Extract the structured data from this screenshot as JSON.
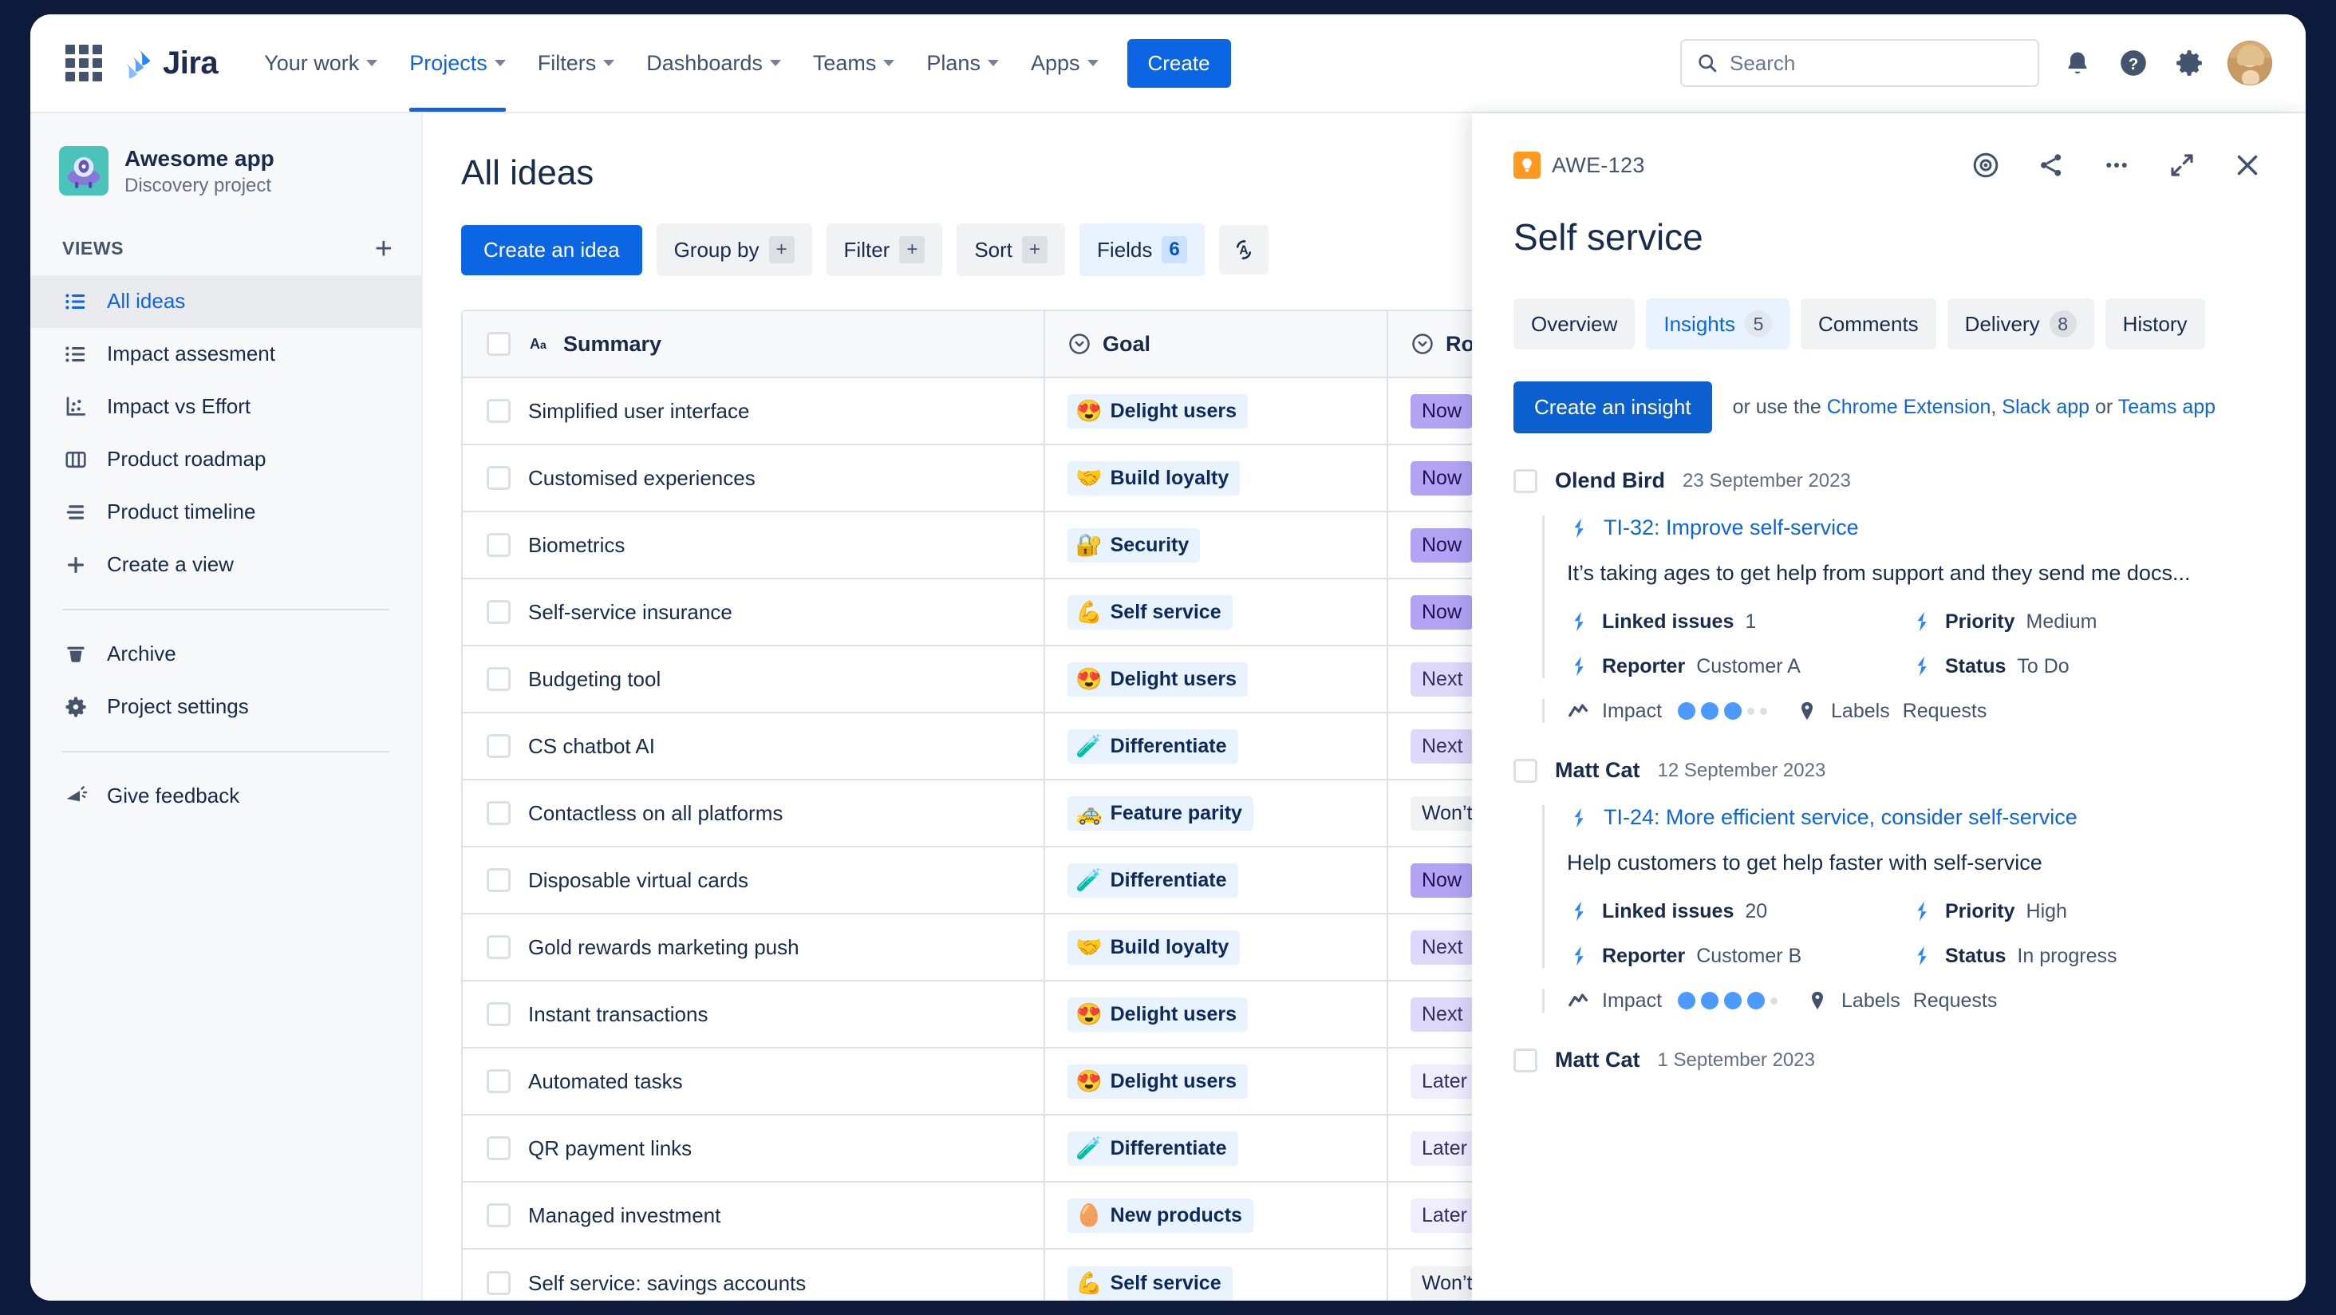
{
  "topnav": {
    "brand": "Jira",
    "items": [
      {
        "label": "Your work",
        "active": false
      },
      {
        "label": "Projects",
        "active": true
      },
      {
        "label": "Filters",
        "active": false
      },
      {
        "label": "Dashboards",
        "active": false
      },
      {
        "label": "Teams",
        "active": false
      },
      {
        "label": "Plans",
        "active": false
      },
      {
        "label": "Apps",
        "active": false
      }
    ],
    "create_label": "Create",
    "search_placeholder": "Search",
    "icons": [
      "notification-bell-icon",
      "help-icon",
      "settings-gear-icon",
      "user-avatar"
    ]
  },
  "sidebar": {
    "project_name": "Awesome app",
    "project_type": "Discovery project",
    "views_label": "VIEWS",
    "add_view_label": "+",
    "views": [
      {
        "label": "All ideas",
        "icon": "list-view-icon",
        "active": true
      },
      {
        "label": "Impact assesment",
        "icon": "list-view-icon",
        "active": false
      },
      {
        "label": "Impact vs Effort",
        "icon": "scatter-chart-icon",
        "active": false
      },
      {
        "label": "Product roadmap",
        "icon": "board-columns-icon",
        "active": false
      },
      {
        "label": "Product timeline",
        "icon": "timeline-icon",
        "active": false
      },
      {
        "label": "Create a view",
        "icon": "plus-icon",
        "active": false
      }
    ],
    "footer_items": [
      {
        "label": "Archive",
        "icon": "trash-icon"
      },
      {
        "label": "Project settings",
        "icon": "gear-icon"
      }
    ],
    "feedback": {
      "label": "Give feedback",
      "icon": "megaphone-icon"
    }
  },
  "main": {
    "page_title": "All ideas",
    "toolbar": {
      "create_idea": "Create an idea",
      "group_by": {
        "label": "Group by",
        "badge": "+"
      },
      "filter": {
        "label": "Filter",
        "badge": "+"
      },
      "sort": {
        "label": "Sort",
        "badge": "+"
      },
      "fields": {
        "label": "Fields",
        "badge": "6"
      },
      "autosize_icon": "text-autosize-icon"
    },
    "table": {
      "columns": [
        {
          "label": "Summary",
          "icon": "text-field-icon"
        },
        {
          "label": "Goal",
          "icon": "select-field-icon"
        },
        {
          "label": "Roadmap",
          "icon": "select-field-icon"
        }
      ],
      "rows": [
        {
          "summary": "Simplified user interface",
          "goal": "Delight users",
          "goal_emoji": "😍",
          "roadmap": "Now",
          "roadmap_style": "now"
        },
        {
          "summary": "Customised experiences",
          "goal": "Build loyalty",
          "goal_emoji": "🤝",
          "roadmap": "Now",
          "roadmap_style": "now"
        },
        {
          "summary": "Biometrics",
          "goal": "Security",
          "goal_emoji": "🔐",
          "roadmap": "Now",
          "roadmap_style": "now"
        },
        {
          "summary": "Self-service insurance",
          "goal": "Self service",
          "goal_emoji": "💪",
          "roadmap": "Now",
          "roadmap_style": "now"
        },
        {
          "summary": "Budgeting tool",
          "goal": "Delight users",
          "goal_emoji": "😍",
          "roadmap": "Next",
          "roadmap_style": "next"
        },
        {
          "summary": "CS chatbot AI",
          "goal": "Differentiate",
          "goal_emoji": "🧪",
          "roadmap": "Next",
          "roadmap_style": "next"
        },
        {
          "summary": "Contactless on all platforms",
          "goal": "Feature parity",
          "goal_emoji": "🚕",
          "roadmap": "Won’t do",
          "roadmap_style": "wont"
        },
        {
          "summary": "Disposable virtual cards",
          "goal": "Differentiate",
          "goal_emoji": "🧪",
          "roadmap": "Now",
          "roadmap_style": "now"
        },
        {
          "summary": "Gold rewards marketing push",
          "goal": "Build loyalty",
          "goal_emoji": "🤝",
          "roadmap": "Next",
          "roadmap_style": "next"
        },
        {
          "summary": "Instant transactions",
          "goal": "Delight users",
          "goal_emoji": "😍",
          "roadmap": "Next",
          "roadmap_style": "next"
        },
        {
          "summary": "Automated tasks",
          "goal": "Delight users",
          "goal_emoji": "😍",
          "roadmap": "Later",
          "roadmap_style": "later"
        },
        {
          "summary": "QR payment links",
          "goal": "Differentiate",
          "goal_emoji": "🧪",
          "roadmap": "Later",
          "roadmap_style": "later"
        },
        {
          "summary": "Managed investment",
          "goal": "New products",
          "goal_emoji": "🥚",
          "roadmap": "Later",
          "roadmap_style": "later"
        },
        {
          "summary": "Self service: savings accounts",
          "goal": "Self service",
          "goal_emoji": "💪",
          "roadmap": "Won’t do",
          "roadmap_style": "wont"
        }
      ]
    }
  },
  "panel": {
    "issue_key": "AWE-123",
    "title": "Self service",
    "actions": [
      "watch-eye-icon",
      "share-icon",
      "more-options-icon",
      "expand-icon",
      "close-icon"
    ],
    "tabs": [
      {
        "label": "Overview",
        "count": null,
        "active": false
      },
      {
        "label": "Insights",
        "count": "5",
        "active": true
      },
      {
        "label": "Comments",
        "count": null,
        "active": false
      },
      {
        "label": "Delivery",
        "count": "8",
        "active": false
      },
      {
        "label": "History",
        "count": null,
        "active": false
      }
    ],
    "cta": {
      "button": "Create an insight",
      "hint_prefix": "or use the ",
      "link1": "Chrome Extension",
      "sep1": ", ",
      "link2": "Slack app",
      "sep2": " or ",
      "link3": "Teams app"
    },
    "insights": [
      {
        "author": "Olend Bird",
        "date": "23 September 2023",
        "link": "TI-32: Improve self-service",
        "text": "It’s taking ages to get help from support and they send me docs...",
        "linked_issues_label": "Linked issues",
        "linked_issues_value": "1",
        "priority_label": "Priority",
        "priority_value": "Medium",
        "reporter_label": "Reporter",
        "reporter_value": "Customer A",
        "status_label": "Status",
        "status_value": "To Do",
        "impact_label": "Impact",
        "impact_filled": 3,
        "impact_total": 5,
        "labels_label": "Labels",
        "requests_label": "Requests"
      },
      {
        "author": "Matt Cat",
        "date": "12 September 2023",
        "link": "TI-24: More efficient service, consider self-service",
        "text": "Help customers to get help faster with self-service",
        "linked_issues_label": "Linked issues",
        "linked_issues_value": "20",
        "priority_label": "Priority",
        "priority_value": "High",
        "reporter_label": "Reporter",
        "reporter_value": "Customer B",
        "status_label": "Status",
        "status_value": "In progress",
        "impact_label": "Impact",
        "impact_filled": 4,
        "impact_total": 5,
        "labels_label": "Labels",
        "requests_label": "Requests"
      }
    ],
    "trailing_insight": {
      "author": "Matt Cat",
      "date": "1 September 2023"
    }
  },
  "colors": {
    "brand_blue": "#0C66E4",
    "roadmap_now": "#B2A3F5",
    "roadmap_next": "#DED8FB",
    "roadmap_later": "#F0EDFD",
    "goal_pill_bg": "#E9F2FF",
    "bulb_orange": "#FF991F"
  }
}
